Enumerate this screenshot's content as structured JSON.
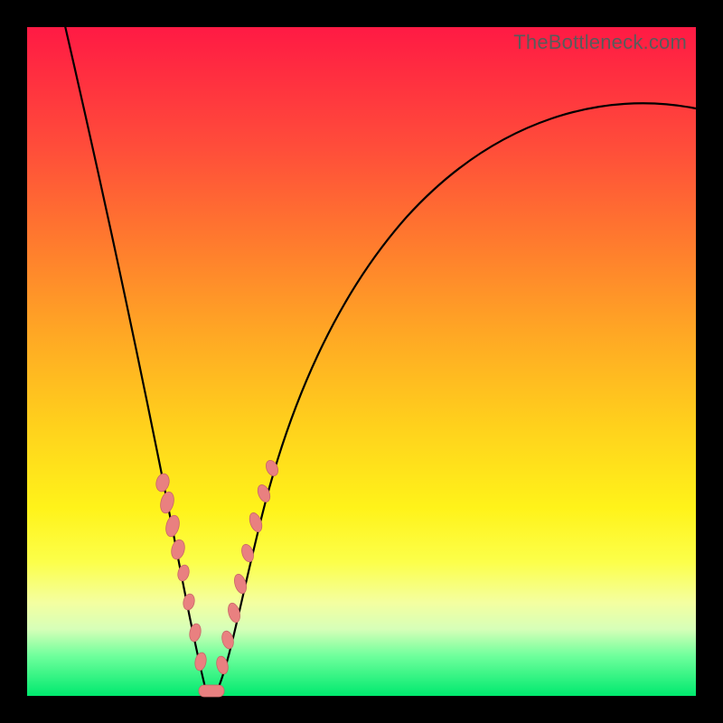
{
  "watermark": "TheBottleneck.com",
  "colors": {
    "background": "#000000",
    "gradient_top": "#ff1a44",
    "gradient_bottom": "#00e96e",
    "curve": "#000000",
    "marker": "#e98080"
  },
  "chart_data": {
    "type": "line",
    "title": "",
    "xlabel": "",
    "ylabel": "",
    "xlim": [
      0,
      100
    ],
    "ylim": [
      0,
      100
    ],
    "grid": false,
    "legend": null,
    "annotations": [
      "TheBottleneck.com"
    ],
    "series": [
      {
        "name": "bottleneck-curve",
        "x": [
          4,
          6,
          8,
          10,
          12,
          14,
          16,
          18,
          20,
          22,
          23,
          24,
          25,
          26,
          27,
          28,
          30,
          32,
          34,
          36,
          38,
          40,
          44,
          48,
          52,
          56,
          60,
          66,
          72,
          80,
          90,
          100
        ],
        "y": [
          100,
          92,
          84,
          76,
          68,
          60,
          52,
          44,
          35,
          25,
          19,
          13,
          7,
          3,
          0,
          0,
          3,
          8,
          14,
          21,
          28,
          34,
          44,
          52,
          59,
          65,
          70,
          75,
          79,
          83,
          86,
          88
        ]
      }
    ],
    "markers": {
      "left_branch": [
        {
          "x": 18.0,
          "y": 40
        },
        {
          "x": 18.8,
          "y": 36
        },
        {
          "x": 19.5,
          "y": 32
        },
        {
          "x": 20.3,
          "y": 28
        },
        {
          "x": 21.0,
          "y": 24
        },
        {
          "x": 22.2,
          "y": 18
        },
        {
          "x": 23.3,
          "y": 12
        },
        {
          "x": 24.2,
          "y": 7
        }
      ],
      "right_branch": [
        {
          "x": 29.2,
          "y": 4
        },
        {
          "x": 30.0,
          "y": 8
        },
        {
          "x": 30.8,
          "y": 13
        },
        {
          "x": 31.6,
          "y": 18
        },
        {
          "x": 32.6,
          "y": 24
        },
        {
          "x": 33.8,
          "y": 30
        },
        {
          "x": 35.0,
          "y": 35
        },
        {
          "x": 36.0,
          "y": 39
        }
      ],
      "bottom_pill": {
        "x_start": 25.0,
        "x_end": 28.5,
        "y": 0
      }
    }
  }
}
